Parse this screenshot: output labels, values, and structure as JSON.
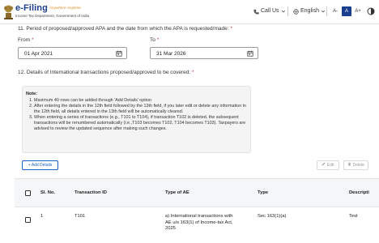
{
  "header": {
    "brand": "e-Filing",
    "brand_tag": "Anywhere Anytime",
    "dept": "Income Tax Department, Government of India",
    "call_us": "Call Us",
    "language": "English",
    "font_controls": [
      "A-",
      "A",
      "A+"
    ]
  },
  "question11": {
    "label": "11. Period of proposed/approved APA and the date from which the APA is requested/made:",
    "required": "*",
    "from_label": "From",
    "from_value": "01 Apr 2021",
    "to_label": "To",
    "to_value": "31 Mar 2026"
  },
  "question12": {
    "label": "12. Details of International transactions proposed/approved to be covered:",
    "required": "*"
  },
  "note": {
    "title": "Note:",
    "items": [
      "Maximum 40 rows can be added through 'Add Details' option",
      "After entering the details in the 12th field followed by the 13th field, if you later edit or delete any information in the 12th field, all details entered in the 13th field will be automatically cleared.",
      "When entering a series of transactions (e.g., T101 to T104), if transaction T102 is deleted, the subsequent transactions will be renumbered automatically (i.e.,T103 becomes T102, T104 becomes T103). Taxpayers are advised to review the updated sequence after making such changes."
    ]
  },
  "actions": {
    "add": "+ Add Details",
    "edit": "Edit",
    "delete": "Delete"
  },
  "table": {
    "columns": [
      "Sl. No.",
      "Transaction ID",
      "Type of AE",
      "Type",
      "Descripti"
    ],
    "rows": [
      {
        "sl": "1",
        "transaction_id": "T101",
        "type_of_ae": "a) International transactions with AE u/s 163(1) of Income-tax Act, 2025",
        "type": "Sec 163(1)(a)",
        "description": "Test"
      }
    ]
  },
  "colors": {
    "primary": "#1c3e8f",
    "accent": "#1c5fc4",
    "required": "#d32f2f"
  }
}
